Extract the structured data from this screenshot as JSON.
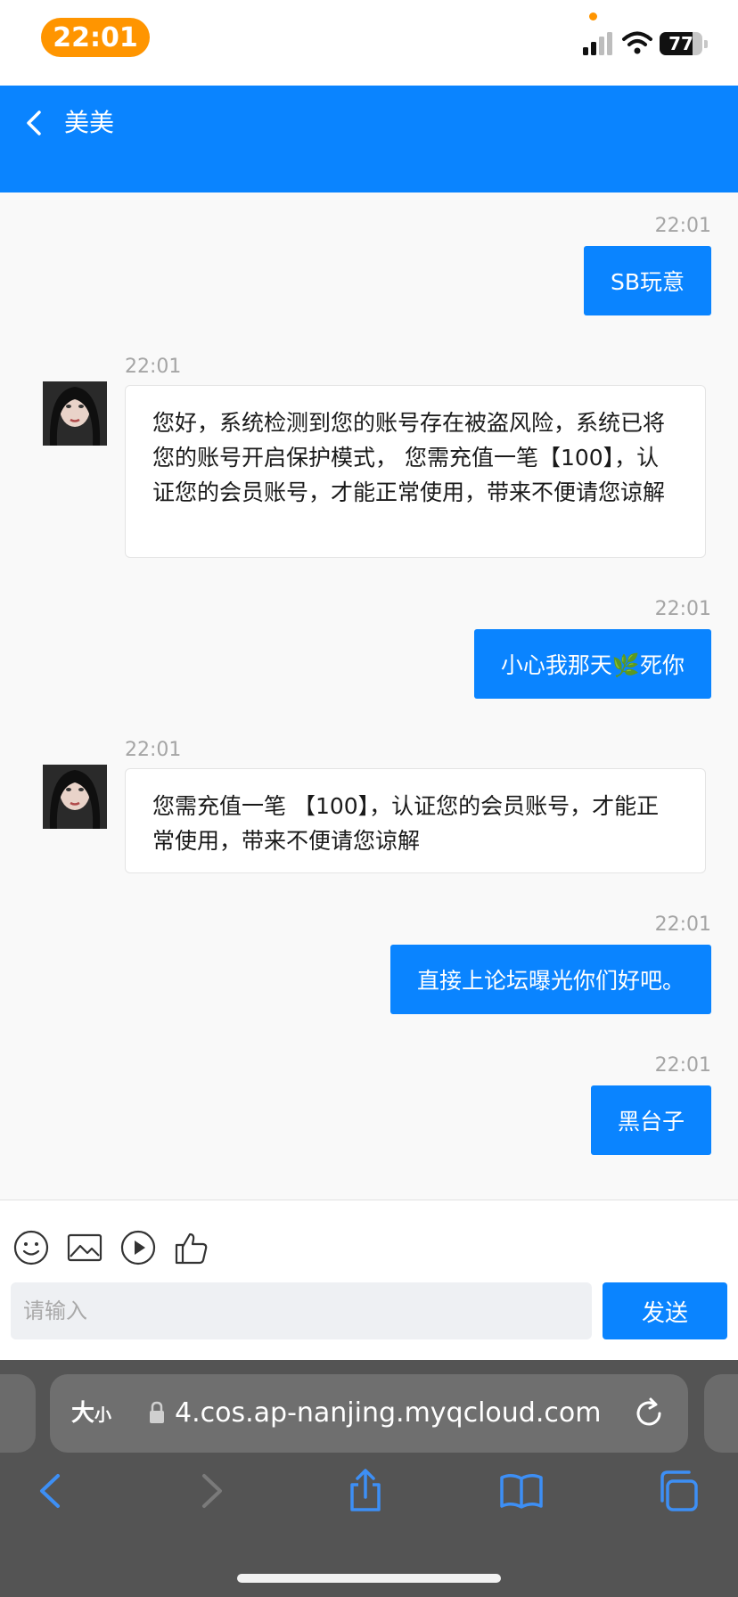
{
  "status_bar": {
    "time": "22:01",
    "battery": "77",
    "battery_level": 0.77,
    "accent": "#ff9500"
  },
  "header": {
    "back_icon": "chevron-left-icon",
    "title": "美美",
    "color": "#0a84ff"
  },
  "messages": [
    {
      "time": "22:01",
      "direction": "out",
      "text": "SB玩意"
    },
    {
      "time": "22:01",
      "direction": "in",
      "text": "您好，系统检测到您的账号存在被盗风险，系统已将您的账号开启保护模式， 您需充值一笔【100】，认证您的会员账号，才能正常使用，带来不便请您谅解"
    },
    {
      "time": "22:01",
      "direction": "out",
      "text": "小心我那天🌿死你"
    },
    {
      "time": "22:01",
      "direction": "in",
      "text": "您需充值一笔 【100】，认证您的会员账号，才能正常使用，带来不便请您谅解"
    },
    {
      "time": "22:01",
      "direction": "out",
      "text": "直接上论坛曝光你们好吧。"
    },
    {
      "time": "22:01",
      "direction": "out",
      "text": "黑台子"
    }
  ],
  "toolbar": {
    "icons": [
      "smile-icon",
      "image-icon",
      "play-icon",
      "thumbs-up-icon"
    ]
  },
  "composer": {
    "placeholder": "请输入",
    "value": "",
    "send_label": "发送"
  },
  "browser": {
    "text_size_big": "大",
    "text_size_small": "小",
    "url": "4.cos.ap-nanjing.myqcloud.com",
    "nav_icons": [
      "back-icon",
      "forward-icon",
      "share-icon",
      "bookmarks-icon",
      "tabs-icon"
    ]
  }
}
